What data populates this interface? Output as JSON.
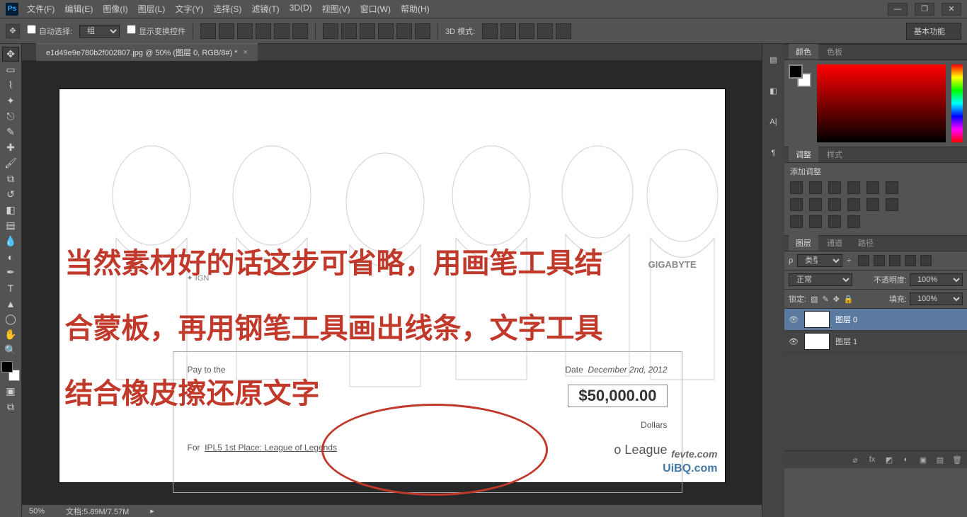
{
  "titlebar": {
    "logo": "Ps",
    "menu": [
      "文件(F)",
      "编辑(E)",
      "图像(I)",
      "图层(L)",
      "文字(Y)",
      "选择(S)",
      "滤镜(T)",
      "3D(D)",
      "视图(V)",
      "窗口(W)",
      "帮助(H)"
    ]
  },
  "options": {
    "auto_select": "自动选择:",
    "group": "组",
    "show_transform": "显示变换控件",
    "mode_3d": "3D 模式:",
    "basic": "基本功能"
  },
  "document": {
    "tab": "e1d49e9e780b2f002807.jpg @ 50% (图层 0, RGB/8#) *",
    "zoom": "50%",
    "docinfo": "文档:5.89M/7.57M"
  },
  "canvas": {
    "overlay_line1": "当然素材好的话这步可省略，用画笔工具结",
    "overlay_line2": "合蒙板，再用钢笔工具画出线条，文字工具",
    "overlay_line3": "结合橡皮擦还原文字",
    "check": {
      "ign": "✦ IGN",
      "gigabyte": "GIGABYTE",
      "payto": "Pay to the",
      "date_label": "Date",
      "date": "December 2nd, 2012",
      "amount": "$50,000.00",
      "dollars": "Dollars",
      "for": "For",
      "for_value": "IPL5 1st Place: League of Legends",
      "league": "o League"
    },
    "watermark1": "fevte.com",
    "watermark2": "UiBQ.com"
  },
  "panels": {
    "color": {
      "tab1": "颜色",
      "tab2": "色板"
    },
    "adjust": {
      "tab1": "调整",
      "tab2": "样式",
      "add": "添加调整"
    },
    "layers": {
      "tab1": "图层",
      "tab2": "通道",
      "tab3": "路径",
      "kind": "类型",
      "blend": "正常",
      "opacity_label": "不透明度:",
      "opacity": "100%",
      "lock": "锁定:",
      "fill_label": "填充:",
      "fill": "100%",
      "items": [
        {
          "name": "图层 0"
        },
        {
          "name": "图层 1"
        }
      ]
    }
  }
}
